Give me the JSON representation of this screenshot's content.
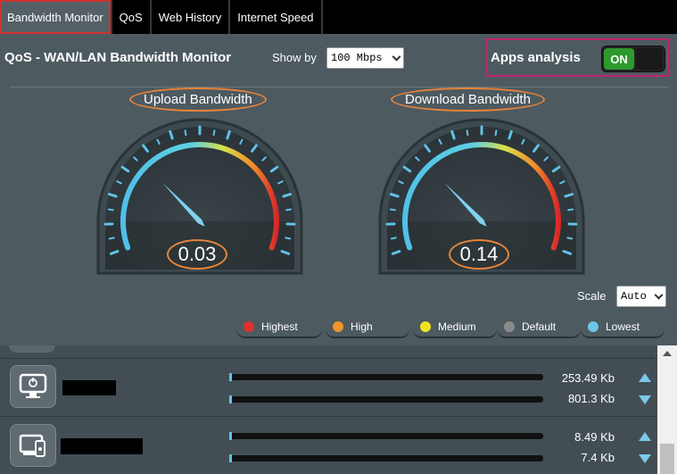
{
  "tabs": [
    "Bandwidth Monitor",
    "QoS",
    "Web History",
    "Internet Speed"
  ],
  "header": {
    "title": "QoS - WAN/LAN Bandwidth Monitor",
    "show_by_label": "Show by",
    "show_by_value": "100 Mbps",
    "apps_analysis_label": "Apps analysis",
    "toggle_label": "ON"
  },
  "gauges": {
    "upload": {
      "label": "Upload Bandwidth",
      "value": "0.03"
    },
    "download": {
      "label": "Download Bandwidth",
      "value": "0.14"
    }
  },
  "scale": {
    "label": "Scale",
    "value": "Auto"
  },
  "legend": [
    {
      "label": "Highest",
      "color": "#e0322c"
    },
    {
      "label": "High",
      "color": "#f0952a"
    },
    {
      "label": "Medium",
      "color": "#f2e21e"
    },
    {
      "label": "Default",
      "color": "#8a8a8a"
    },
    {
      "label": "Lowest",
      "color": "#6cc6ea"
    }
  ],
  "devices": [
    {
      "icon": "computer-icon",
      "upload": "253.49 Kb",
      "download": "801.3 Kb"
    },
    {
      "icon": "device-icon",
      "upload": "8.49 Kb",
      "download": "7.4 Kb"
    }
  ],
  "colors": {
    "accent": "#5fc3e8",
    "highlight_box": "#c2246e",
    "annotation": "#e8843a",
    "toggle_on": "#2d9a2d"
  }
}
